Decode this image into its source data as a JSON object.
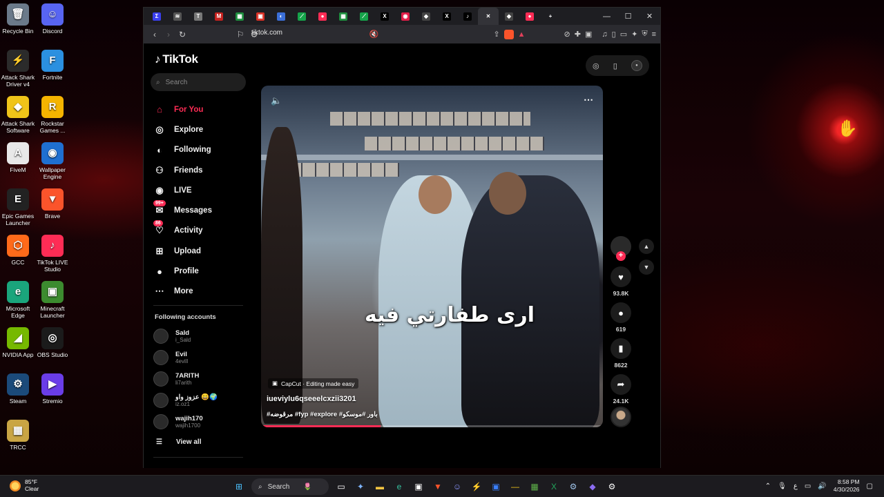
{
  "desktop": {
    "icons": [
      {
        "label": "Recycle Bin",
        "icon": "recycle-bin-icon",
        "color": "#6b7a8a",
        "glyph": "🗑"
      },
      {
        "label": "Discord",
        "icon": "discord-icon",
        "color": "#5865f2",
        "glyph": "☺"
      },
      {
        "label": "Attack Shark Driver v4",
        "icon": "attack-shark-icon",
        "color": "#2b2b2b",
        "glyph": "⚡"
      },
      {
        "label": "Fortnite",
        "icon": "fortnite-icon",
        "color": "#2b90e0",
        "glyph": "F"
      },
      {
        "label": "Attack Shark Software",
        "icon": "attack-shark-software-icon",
        "color": "#f0c419",
        "glyph": "◆"
      },
      {
        "label": "Rockstar Games ...",
        "icon": "rockstar-icon",
        "color": "#f5b400",
        "glyph": "R"
      },
      {
        "label": "FiveM",
        "icon": "fivem-icon",
        "color": "#e8e8e8",
        "glyph": "A"
      },
      {
        "label": "Wallpaper Engine",
        "icon": "wallpaper-engine-icon",
        "color": "#1f6fd1",
        "glyph": "◉"
      },
      {
        "label": "Epic Games Launcher",
        "icon": "epic-games-icon",
        "color": "#222222",
        "glyph": "E"
      },
      {
        "label": "Brave",
        "icon": "brave-icon",
        "color": "#fb542b",
        "glyph": "▼"
      },
      {
        "label": "GCC",
        "icon": "gcc-icon",
        "color": "#ff6a1a",
        "glyph": "⬡"
      },
      {
        "label": "TikTok LIVE Studio",
        "icon": "tiktok-live-studio-icon",
        "color": "#fe2c55",
        "glyph": "♪"
      },
      {
        "label": "Microsoft Edge",
        "icon": "edge-icon",
        "color": "#1aa57c",
        "glyph": "e"
      },
      {
        "label": "Minecraft Launcher",
        "icon": "minecraft-icon",
        "color": "#3c8b2f",
        "glyph": "▣"
      },
      {
        "label": "NVIDIA App",
        "icon": "nvidia-icon",
        "color": "#76b900",
        "glyph": "◢"
      },
      {
        "label": "OBS Studio",
        "icon": "obs-icon",
        "color": "#1b1b1b",
        "glyph": "◎"
      },
      {
        "label": "Steam",
        "icon": "steam-icon",
        "color": "#1b4a7a",
        "glyph": "⚙"
      },
      {
        "label": "Stremio",
        "icon": "stremio-icon",
        "color": "#6a3de8",
        "glyph": "▶"
      },
      {
        "label": "TRCC",
        "icon": "trcc-icon",
        "color": "#c9a544",
        "glyph": "▦"
      }
    ]
  },
  "browser": {
    "url": "tiktok.com",
    "tabs": [
      {
        "icon": "brave-tab-icon",
        "color": "#3a3ff0",
        "glyph": "Σ"
      },
      {
        "icon": "tab-icon-2",
        "color": "#555555",
        "glyph": "≋"
      },
      {
        "icon": "tab-icon-3",
        "color": "#777777",
        "glyph": "T"
      },
      {
        "icon": "gmail-tab-icon",
        "color": "#c5221f",
        "glyph": "M"
      },
      {
        "icon": "sheets-tab-icon",
        "color": "#1e8e3e",
        "glyph": "▦"
      },
      {
        "icon": "tab-icon-6",
        "color": "#d93025",
        "glyph": "▣"
      },
      {
        "icon": "tab-icon-7",
        "color": "#3b6fd8",
        "glyph": "◐"
      },
      {
        "icon": "tab-icon-8",
        "color": "#16a34a",
        "glyph": "⟋"
      },
      {
        "icon": "tab-icon-9",
        "color": "#fe2c55",
        "glyph": "●"
      },
      {
        "icon": "sheets-tab-icon-2",
        "color": "#1e8e3e",
        "glyph": "▦"
      },
      {
        "icon": "tab-icon-11",
        "color": "#16a34a",
        "glyph": "⟋"
      },
      {
        "icon": "x-tab-icon",
        "color": "#000000",
        "glyph": "X"
      },
      {
        "icon": "tab-icon-13",
        "color": "#e11d48",
        "glyph": "◉"
      },
      {
        "icon": "tab-icon-14",
        "color": "#444444",
        "glyph": "◆"
      },
      {
        "icon": "x-tab-icon-2",
        "color": "#000000",
        "glyph": "X"
      },
      {
        "icon": "tiktok-tab-icon",
        "color": "#000000",
        "glyph": "♪"
      },
      {
        "icon": "close-tab-icon",
        "color": "#333338",
        "glyph": "✕"
      },
      {
        "icon": "tab-icon-18",
        "color": "#444444",
        "glyph": "◆"
      },
      {
        "icon": "tab-icon-19",
        "color": "#fe2c55",
        "glyph": "●"
      },
      {
        "icon": "new-tab-icon",
        "color": "#1e1e22",
        "glyph": "+"
      }
    ]
  },
  "tiktok": {
    "logo": "TikTok",
    "search_placeholder": "Search",
    "menu": [
      {
        "label": "For You",
        "icon": "home-icon",
        "glyph": "⌂",
        "active": true,
        "badge": ""
      },
      {
        "label": "Explore",
        "icon": "compass-icon",
        "glyph": "◎",
        "active": false,
        "badge": ""
      },
      {
        "label": "Following",
        "icon": "following-avatar-icon",
        "glyph": "◐",
        "active": false,
        "badge": ""
      },
      {
        "label": "Friends",
        "icon": "friends-icon",
        "glyph": "⚇",
        "active": false,
        "badge": ""
      },
      {
        "label": "LIVE",
        "icon": "live-icon",
        "glyph": "◉",
        "active": false,
        "badge": ""
      },
      {
        "label": "Messages",
        "icon": "messages-icon",
        "glyph": "✉",
        "active": false,
        "badge": "99+"
      },
      {
        "label": "Activity",
        "icon": "activity-icon",
        "glyph": "♡",
        "active": false,
        "badge": "86"
      },
      {
        "label": "Upload",
        "icon": "upload-icon",
        "glyph": "⊞",
        "active": false,
        "badge": ""
      },
      {
        "label": "Profile",
        "icon": "profile-icon",
        "glyph": "●",
        "active": false,
        "badge": ""
      },
      {
        "label": "More",
        "icon": "more-icon",
        "glyph": "⋯",
        "active": false,
        "badge": ""
      }
    ],
    "following_title": "Following accounts",
    "following": [
      {
        "name": "Sald",
        "handle": "i_Sald"
      },
      {
        "name": "Evil",
        "handle": "4evill"
      },
      {
        "name": "7ARITH",
        "handle": "li7arith"
      },
      {
        "name": "عزوز واو 😄🌍",
        "handle": "iz.oz1"
      },
      {
        "name": "wajih170",
        "handle": "wajih1700"
      }
    ],
    "view_all": "View all",
    "video": {
      "caption_text": "ارى طفارتي فيه",
      "capcut_label": "CapCut · Editing made easy",
      "author": "iueviylu6qseeelcxzii3201",
      "tags": "#مرقوضه #fyp #explore #باور #موسكو",
      "progress": 0.35
    },
    "actions": {
      "likes": "93.8K",
      "comments": "619",
      "saves": "8622",
      "shares": "24.1K"
    }
  },
  "taskbar": {
    "weather_temp": "85°F",
    "weather_desc": "Clear",
    "search_label": "Search",
    "time": "8:58 PM",
    "date": "4/30/2026",
    "lang": "ع"
  }
}
